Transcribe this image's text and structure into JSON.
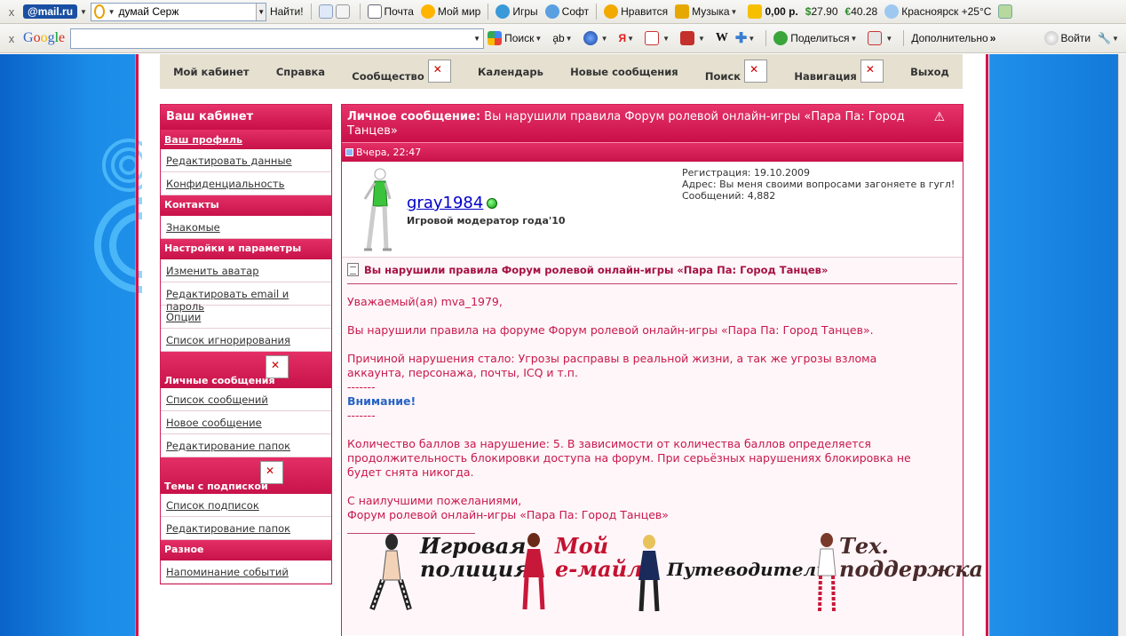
{
  "toolbar1": {
    "close": "x",
    "mailru_logo": "@mail.ru",
    "search_value": "думай Серж",
    "find": "Найти!",
    "mail": "Почта",
    "myworld": "Мой мир",
    "games": "Игры",
    "soft": "Софт",
    "likes": "Нравится",
    "music": "Музыка",
    "balance": "0,00 р.",
    "usd": "27.90",
    "eur": "40.28",
    "weather": "Красноярск +25°С"
  },
  "toolbar2": {
    "close": "x",
    "google_logo": "Google",
    "search_btn": "Поиск",
    "share": "Поделиться",
    "more": "Дополнительно",
    "login": "Войти"
  },
  "topnav": {
    "items": [
      "Мой кабинет",
      "Справка",
      "Сообщество",
      "Календарь",
      "Новые сообщения",
      "Поиск",
      "Навигация",
      "Выход"
    ]
  },
  "sidebar": {
    "title": "Ваш кабинет",
    "profile": "Ваш профиль",
    "edit_data": "Редактировать данные",
    "privacy": "Конфиденциальность",
    "contacts": "Контакты",
    "friends": "Знакомые",
    "settings": "Настройки и параметры",
    "change_avatar": "Изменить аватар",
    "edit_email": "Редактировать email и пароль",
    "options": "Опции",
    "ignore": "Список игнорирования",
    "pm": "Личные сообщения",
    "msg_list": "Список сообщений",
    "new_msg": "Новое сообщение",
    "edit_folders": "Редактирование папок",
    "subs": "Темы с подпиской",
    "subs_list": "Список подписок",
    "subs_folders": "Редактирование папок",
    "misc": "Разное",
    "reminders": "Напоминание событий"
  },
  "message": {
    "head_label": "Личное сообщение:",
    "head_title": "Вы нарушили правила Форум ролевой онлайн-игры «Пара Па: Город Танцев»",
    "date": "Вчера, 22:47",
    "author": "gray1984",
    "author_title": "Игровой модератор года'10",
    "reg": "Регистрация: 19.10.2009",
    "address": "Адрес: Вы меня своими вопросами загоняете в гугл!",
    "posts": "Сообщений: 4,882",
    "title": "Вы нарушили правила Форум ролевой онлайн-игры «Пара Па: Город Танцев»",
    "greeting": "Уважаемый(ая) mva_1979,",
    "line1": "Вы нарушили правила на форуме Форум ролевой онлайн-игры «Пара Па: Город Танцев».",
    "reason": "Причиной нарушения стало: Угрозы расправы в реальной жизни, а так же угрозы взлома\nаккаунта, персонажа, почты, ICQ и т.п.",
    "dash": "-------",
    "attention": "Внимание!",
    "points": "Количество баллов за нарушение: 5. В зависимости от количества баллов определяется\nпродолжительность блокировки доступа на форум. При серьёзных нарушениях блокировка не\nбудет снята никогда.",
    "regards": "С наилучшими пожеланиями,\nФорум ролевой онлайн-игры «Пара Па: Город Танцев»"
  },
  "banners": {
    "b1": "Игровая\nполиция",
    "b2": "Мой\ne-майл",
    "b3": "Путеводитель",
    "b4": "Тех.\nподдержка"
  },
  "colors": {
    "accent": "#cf1450",
    "link": "#2764c5"
  }
}
